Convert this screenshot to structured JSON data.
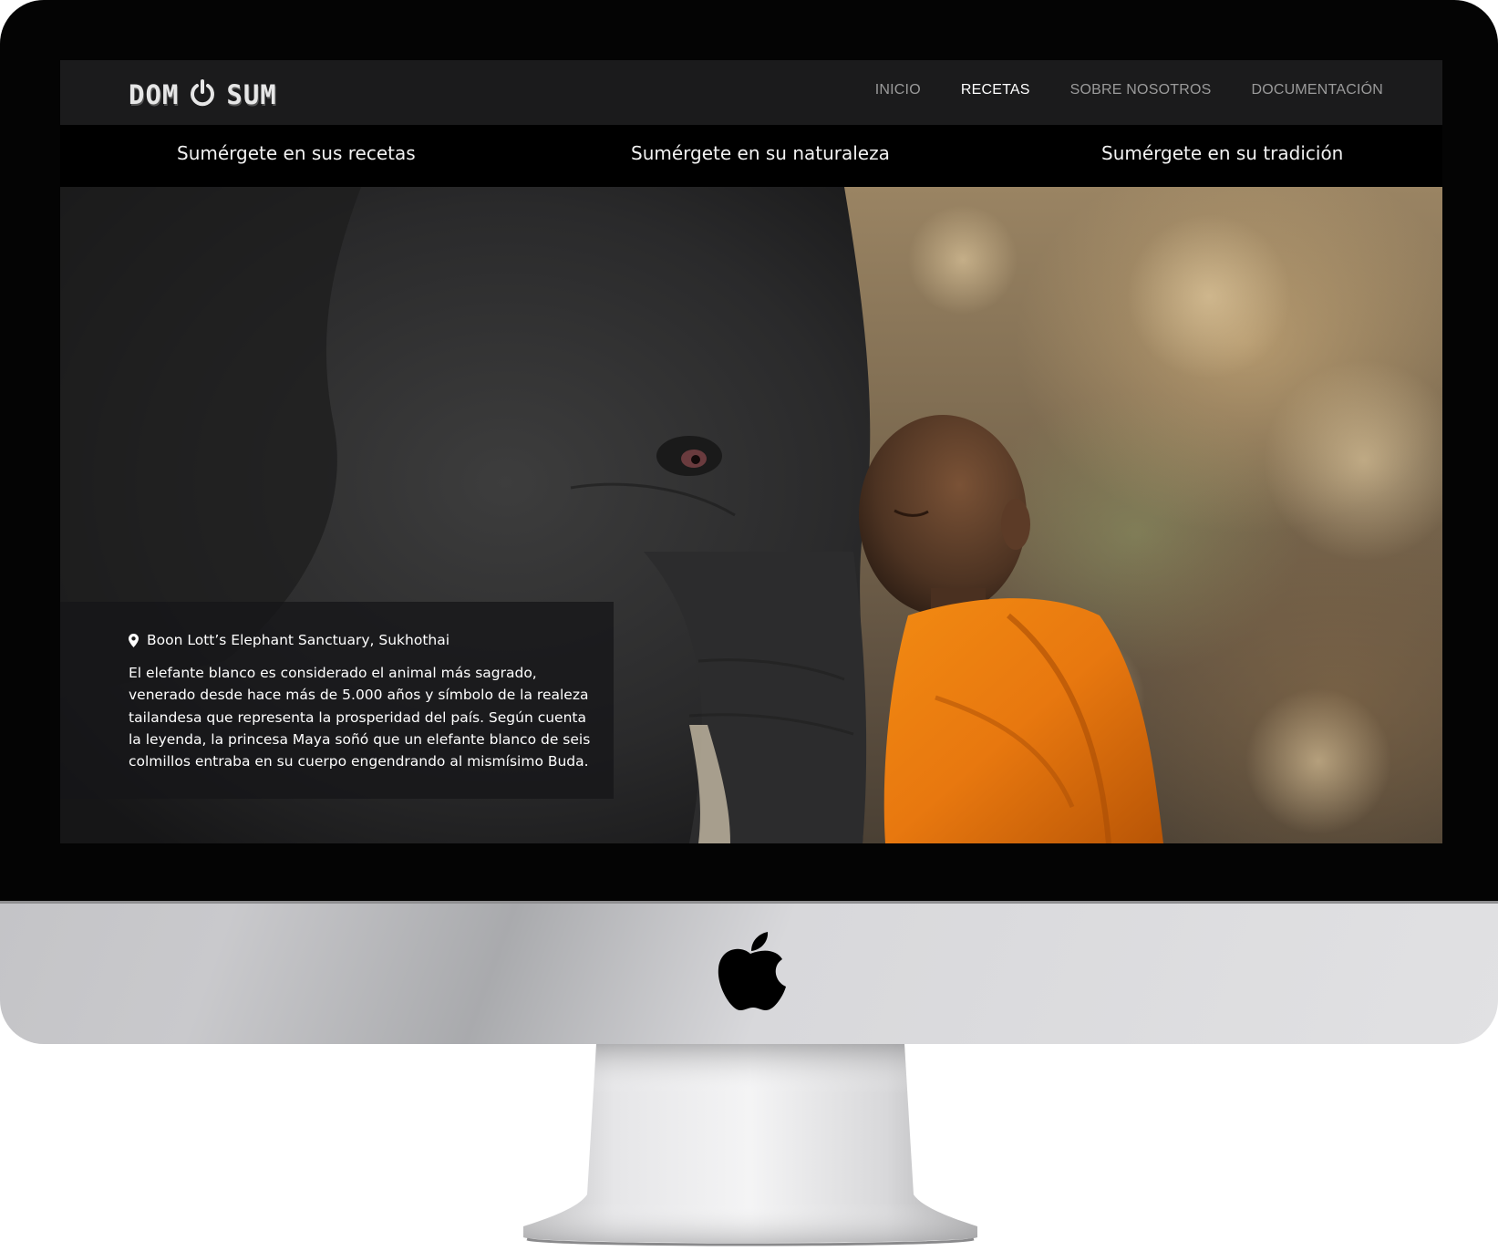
{
  "site": {
    "logo": {
      "left_text": "DOM",
      "right_text": "SUM",
      "icon": "power-icon"
    },
    "nav": [
      {
        "label": "INICIO",
        "active": false
      },
      {
        "label": "RECETAS",
        "active": true
      },
      {
        "label": "SOBRE NOSOTROS",
        "active": false
      },
      {
        "label": "DOCUMENTACIÓN",
        "active": false
      }
    ],
    "taglines": [
      "Sumérgete en sus recetas",
      "Sumérgete en su naturaleza",
      "Sumérgete en su tradición"
    ],
    "hero": {
      "location_icon": "map-pin-icon",
      "location": "Boon Lott’s Elephant Sanctuary, Sukhothai",
      "description": "El elefante blanco es considerado el animal más sagrado, venerado desde hace más de 5.000 años y símbolo de la realeza tailandesa que representa la prosperidad del país. Según cuenta la leyenda, la princesa Maya soñó que un elefante blanco de seis colmillos entraba en su cuerpo engendrando al mismísimo Buda."
    }
  },
  "device": {
    "brand_icon": "apple-logo-icon"
  },
  "colors": {
    "navbar_bg": "#1b1b1c",
    "nav_active": "#ffffff",
    "nav_inactive": "#9a9a9a",
    "robe_orange": "#e8780f",
    "bezel": "#040404"
  }
}
